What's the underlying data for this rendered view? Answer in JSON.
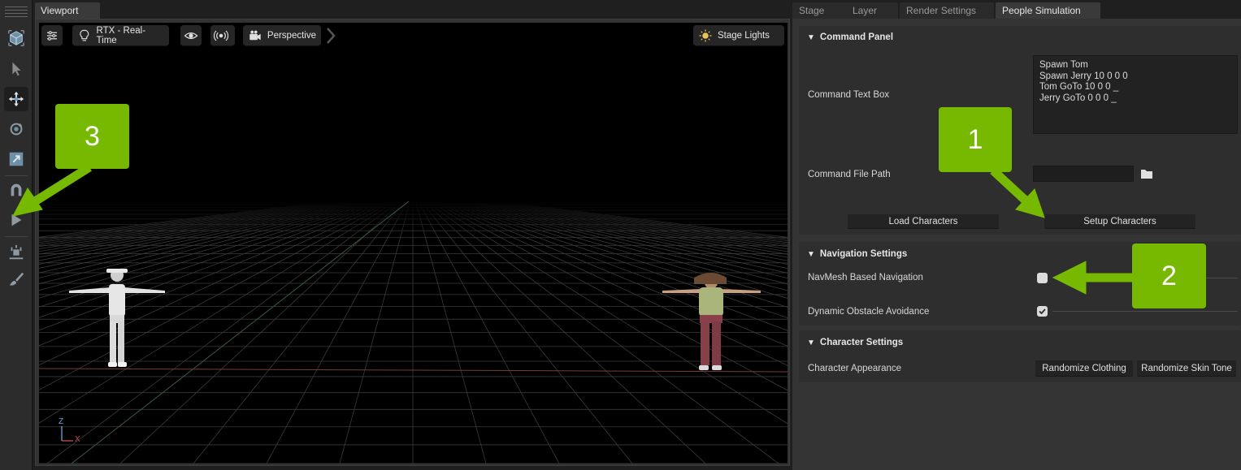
{
  "viewport": {
    "tab_label": "Viewport",
    "toolbar": {
      "renderer_label": "RTX - Real-Time",
      "camera_label": "Perspective",
      "lights_label": "Stage Lights"
    },
    "axis": {
      "up": "Z",
      "right": "X"
    }
  },
  "left_toolbar": {
    "tools": [
      "cube-select-icon",
      "arrow-select-icon",
      "move-icon",
      "rotate-icon",
      "scale-icon",
      "snap-magnet-icon",
      "play-icon",
      "physics-icon",
      "paint-brush-icon"
    ],
    "active_tool": "move-icon"
  },
  "panel": {
    "tabs": [
      {
        "label": "Stage",
        "active": false
      },
      {
        "label": "Layer",
        "active": false
      },
      {
        "label": "Render Settings",
        "active": false
      },
      {
        "label": "People Simulation",
        "active": true
      }
    ],
    "command_panel": {
      "title": "Command Panel",
      "text_box_label": "Command Text Box",
      "text_box_value": "Spawn Tom\nSpawn Jerry 10 0 0 0\nTom GoTo 10 0 0 _\nJerry GoTo 0 0 0 _",
      "file_path_label": "Command File Path",
      "file_path_value": "",
      "load_button": "Load Characters",
      "setup_button": "Setup Characters"
    },
    "navigation_settings": {
      "title": "Navigation Settings",
      "navmesh_label": "NavMesh Based Navigation",
      "navmesh_checked": false,
      "avoidance_label": "Dynamic Obstacle Avoidance",
      "avoidance_checked": true
    },
    "character_settings": {
      "title": "Character Settings",
      "appearance_label": "Character Appearance",
      "randomize_clothing": "Randomize Clothing",
      "randomize_skin": "Randomize Skin Tone"
    }
  },
  "callouts": {
    "one": "1",
    "two": "2",
    "three": "3"
  },
  "colors": {
    "callout_green": "#76b900",
    "panel_bg": "#343434",
    "section_bg": "#2e2e2e",
    "viewport_bg": "#000000"
  }
}
